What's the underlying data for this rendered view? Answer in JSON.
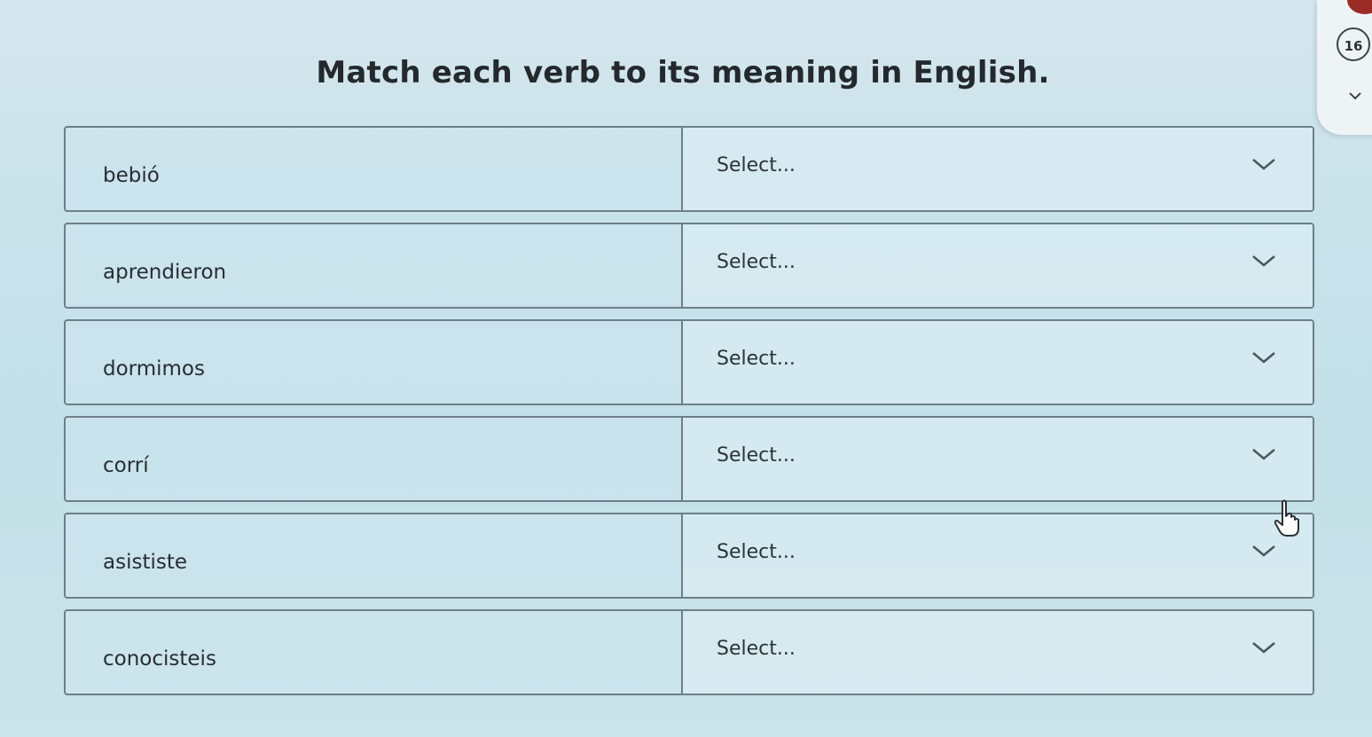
{
  "title": "Match each verb to its meaning in English.",
  "question_number": "16",
  "rows": [
    {
      "verb": "bebió",
      "select": "Select..."
    },
    {
      "verb": "aprendieron",
      "select": "Select..."
    },
    {
      "verb": "dormimos",
      "select": "Select..."
    },
    {
      "verb": "corrí",
      "select": "Select..."
    },
    {
      "verb": "asististe",
      "select": "Select..."
    },
    {
      "verb": "conocisteis",
      "select": "Select..."
    }
  ],
  "icons": {
    "dropdown": "chevron-down-icon",
    "side_toggle": "chevron-down-icon",
    "pointer": "hand-pointer-icon"
  },
  "colors": {
    "background": "#c8e2ea",
    "border": "#6d7f88",
    "text": "#23292d"
  }
}
